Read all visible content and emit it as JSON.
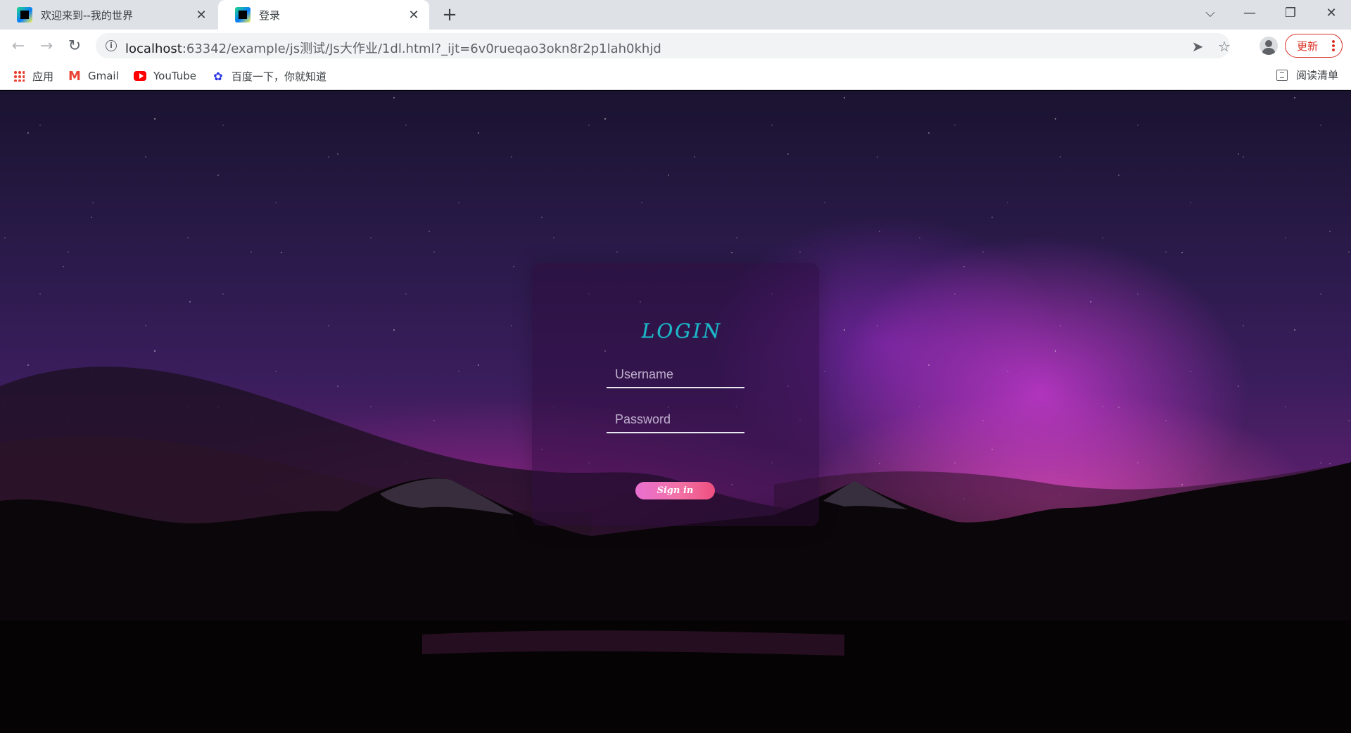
{
  "browser": {
    "tabs": [
      {
        "title": "欢迎来到--我的世界",
        "active": false
      },
      {
        "title": "登录",
        "active": true
      }
    ],
    "new_tab_label": "+",
    "url_host": "localhost",
    "url_rest": ":63342/example/js测试/Js大作业/1dl.html?_ijt=6v0rueqao3okn8r2p1lah0khjd",
    "update_label": "更新",
    "bookmarks": [
      {
        "label": "应用",
        "icon": "apps-grid-icon"
      },
      {
        "label": "Gmail",
        "icon": "gmail-icon"
      },
      {
        "label": "YouTube",
        "icon": "youtube-icon"
      },
      {
        "label": "百度一下，你就知道",
        "icon": "baidu-paw-icon"
      }
    ],
    "reading_list_label": "阅读清单"
  },
  "login": {
    "title": "LOGIN",
    "username_placeholder": "Username",
    "password_placeholder": "Password",
    "signin_label": "Sign in"
  },
  "colors": {
    "title": "#1fb7c8",
    "signin_gradient_start": "#e86fd0",
    "signin_gradient_end": "#ee4f7e",
    "update_red": "#d93025"
  }
}
